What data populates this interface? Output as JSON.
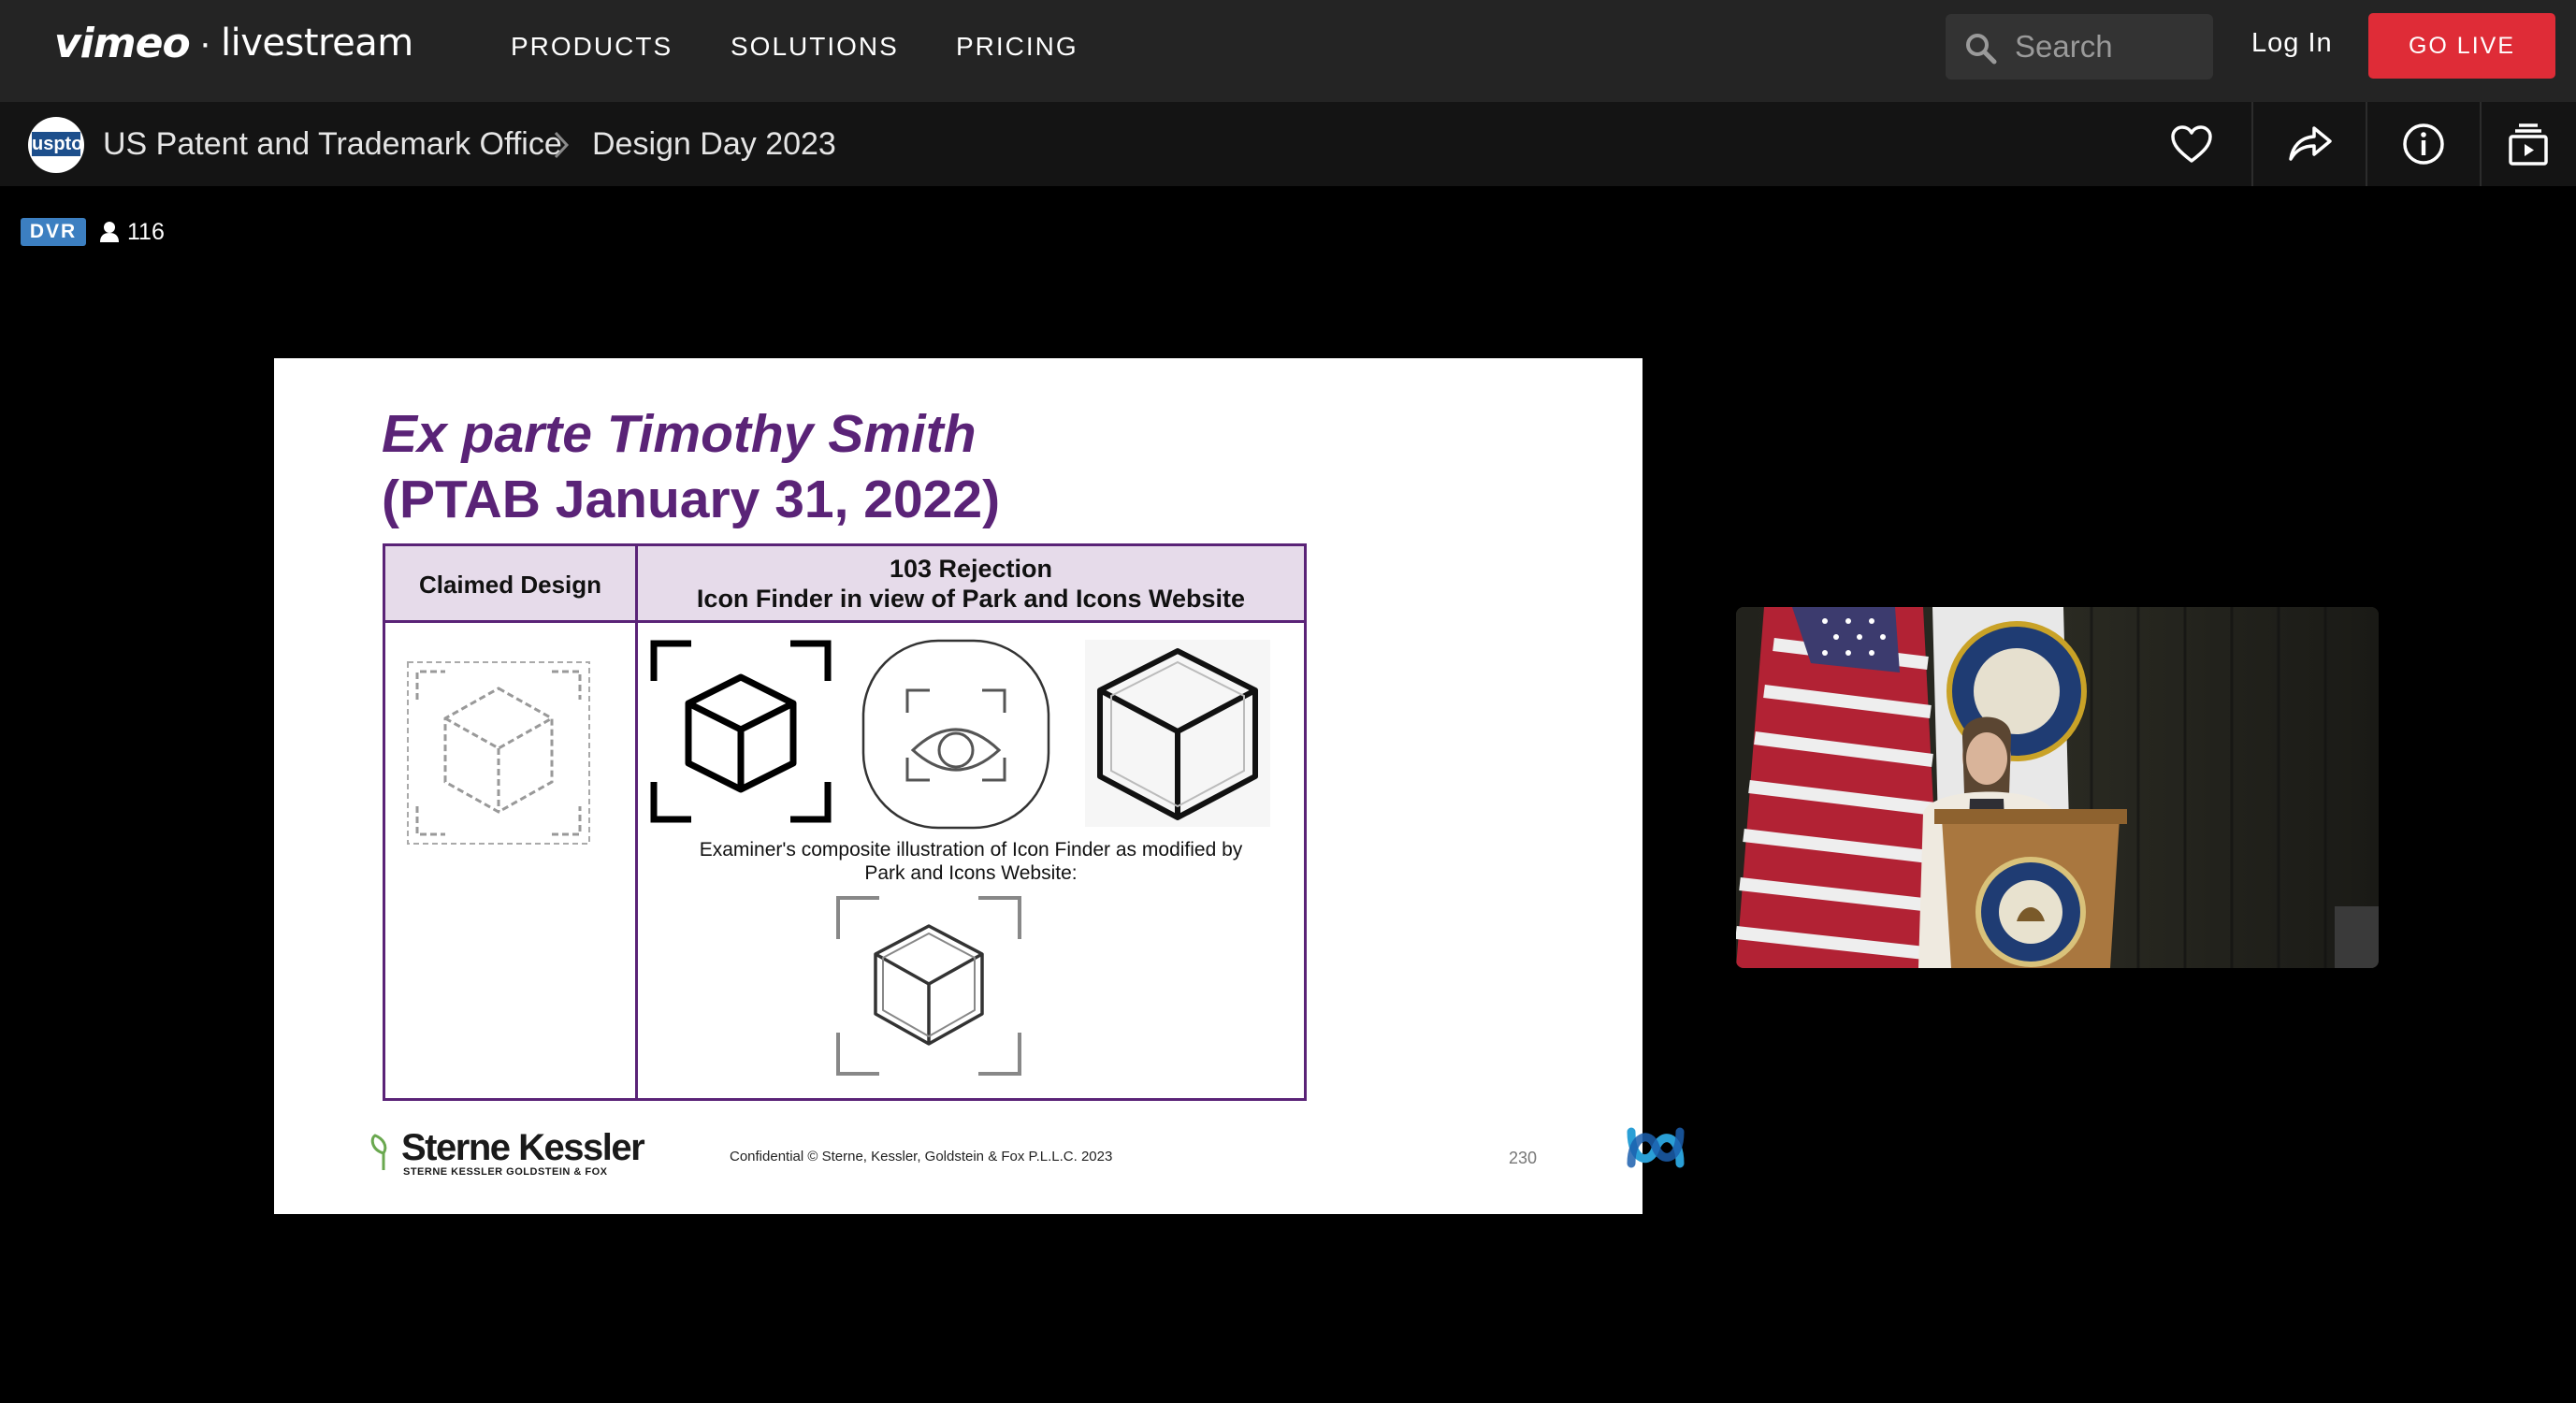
{
  "brand": {
    "vimeo": "vimeo",
    "livestream": "livestream"
  },
  "nav": {
    "products": "PRODUCTS",
    "solutions": "SOLUTIONS",
    "pricing": "PRICING"
  },
  "search": {
    "placeholder": "Search"
  },
  "auth": {
    "login": "Log In",
    "go_live": "GO LIVE"
  },
  "channel": {
    "avatar_text": "uspto",
    "owner": "US Patent and Trademark Office",
    "event": "Design Day 2023"
  },
  "status": {
    "dvr": "DVR",
    "viewers": "116"
  },
  "slide": {
    "title_line1": "Ex parte Timothy Smith",
    "title_line2": "(PTAB January 31, 2022)",
    "col_left": "Claimed Design",
    "col_right_line1": "103 Rejection",
    "col_right_line2": "Icon Finder in view of Park and Icons Website",
    "caption_line1": "Examiner's composite illustration of Icon Finder as modified by",
    "caption_line2": "Park and Icons Website:",
    "firm_name": "Sterne Kessler",
    "firm_sub": "STERNE KESSLER GOLDSTEIN & FOX",
    "confidential": "Confidential  © Sterne, Kessler, Goldstein & Fox P.L.L.C. 2023",
    "page": "230"
  },
  "colors": {
    "accent_red": "#df2c37",
    "dvr_blue": "#3c7fc1",
    "slide_purple": "#5a2377",
    "header_bg": "#242424"
  },
  "icons": [
    "search-icon",
    "heart-icon",
    "share-icon",
    "info-icon",
    "collection-icon",
    "user-icon",
    "chevron-right-icon",
    "webex-icon"
  ]
}
